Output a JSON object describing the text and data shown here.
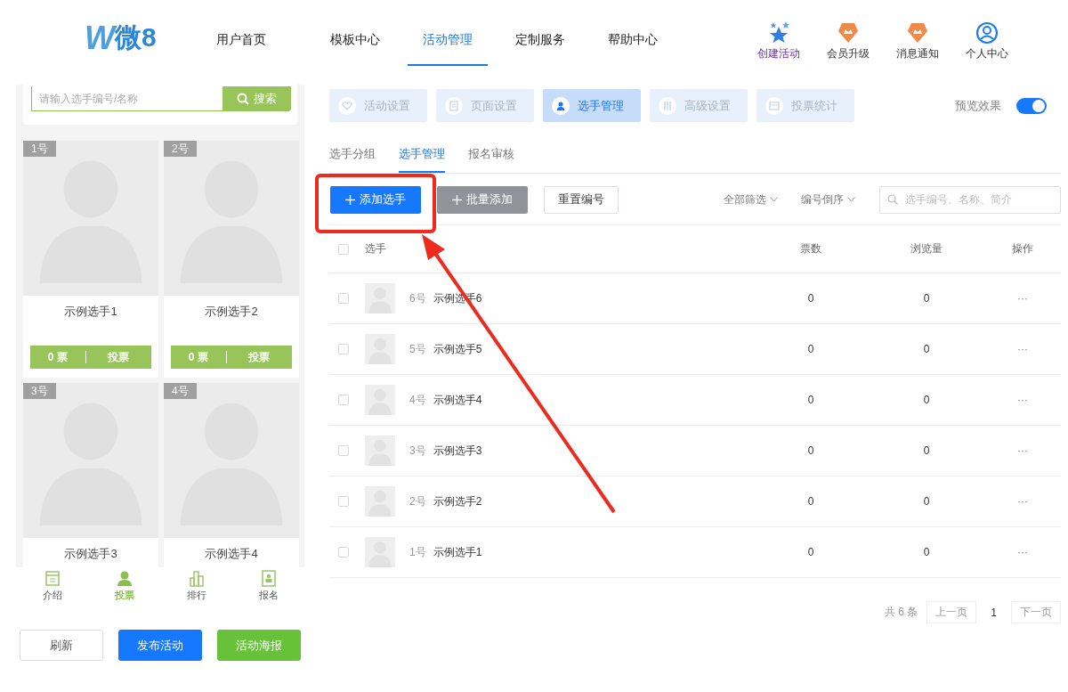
{
  "header": {
    "logo": {
      "mark": "W",
      "text": "微8"
    },
    "nav": [
      {
        "label": "用户首页",
        "selected": false
      },
      {
        "label": "模板中心",
        "selected": false
      },
      {
        "label": "活动管理",
        "selected": true
      },
      {
        "label": "定制服务",
        "selected": false
      },
      {
        "label": "帮助中心",
        "selected": false
      }
    ],
    "actions": [
      {
        "kind": "star",
        "label": "创建活动"
      },
      {
        "kind": "badge",
        "label": "会员升级"
      },
      {
        "kind": "badge",
        "label": "消息通知"
      },
      {
        "kind": "user",
        "label": "个人中心"
      }
    ]
  },
  "preview": {
    "search": {
      "placeholder": "请输入选手编号/名称",
      "button": "搜索"
    },
    "cards": [
      {
        "number": "1号",
        "name": "示例选手1",
        "votes": "0 票",
        "vote_button": "投票"
      },
      {
        "number": "2号",
        "name": "示例选手2",
        "votes": "0 票",
        "vote_button": "投票"
      },
      {
        "number": "3号",
        "name": "示例选手3"
      },
      {
        "number": "4号",
        "name": "示例选手4"
      }
    ],
    "tabbar": [
      {
        "kind": "intro",
        "label": "介绍",
        "selected": false
      },
      {
        "kind": "vote",
        "label": "投票",
        "selected": true
      },
      {
        "kind": "rank",
        "label": "排行",
        "selected": false
      },
      {
        "kind": "signup",
        "label": "报名",
        "selected": false
      }
    ]
  },
  "preview_buttons": [
    {
      "kind": "outline",
      "label": "刷新"
    },
    {
      "kind": "primary",
      "label": "发布活动"
    },
    {
      "kind": "success",
      "label": "活动海报"
    }
  ],
  "steps": [
    {
      "kind": "heart",
      "label": "活动设置",
      "selected": false
    },
    {
      "kind": "page",
      "label": "页面设置",
      "selected": false
    },
    {
      "kind": "person",
      "label": "选手管理",
      "selected": true
    },
    {
      "kind": "tools",
      "label": "高级设置",
      "selected": false
    },
    {
      "kind": "stats",
      "label": "投票统计",
      "selected": false
    }
  ],
  "preview_toggle": {
    "label": "预览效果",
    "on": true
  },
  "subtabs": [
    {
      "label": "选手分组",
      "selected": false
    },
    {
      "label": "选手管理",
      "selected": true
    },
    {
      "label": "报名审核",
      "selected": false
    }
  ],
  "toolbar": {
    "buttons": [
      {
        "kind": "primary",
        "label": "添加选手",
        "plus": true
      },
      {
        "kind": "grey",
        "label": "批量添加",
        "plus": true
      },
      {
        "kind": "outline",
        "label": "重置编号",
        "plus": false
      }
    ],
    "filters": [
      {
        "label": "全部筛选"
      },
      {
        "label": "编号倒序"
      }
    ],
    "search": {
      "placeholder": "选手编号、名称、简介"
    }
  },
  "table": {
    "all_checked": false,
    "columns": [
      "选手",
      "票数",
      "浏览量",
      "操作"
    ],
    "rows": [
      {
        "checked": false,
        "number": "6号",
        "name": "示例选手6",
        "votes": "0",
        "views": "0",
        "action": "···"
      },
      {
        "checked": false,
        "number": "5号",
        "name": "示例选手5",
        "votes": "0",
        "views": "0",
        "action": "···"
      },
      {
        "checked": false,
        "number": "4号",
        "name": "示例选手4",
        "votes": "0",
        "views": "0",
        "action": "···"
      },
      {
        "checked": false,
        "number": "3号",
        "name": "示例选手3",
        "votes": "0",
        "views": "0",
        "action": "···"
      },
      {
        "checked": false,
        "number": "2号",
        "name": "示例选手2",
        "votes": "0",
        "views": "0",
        "action": "···"
      },
      {
        "checked": false,
        "number": "1号",
        "name": "示例选手1",
        "votes": "0",
        "views": "0",
        "action": "···"
      }
    ]
  },
  "pagination": {
    "total": "共 6 条",
    "prev": "上一页",
    "page": "1",
    "next": "下一页"
  }
}
